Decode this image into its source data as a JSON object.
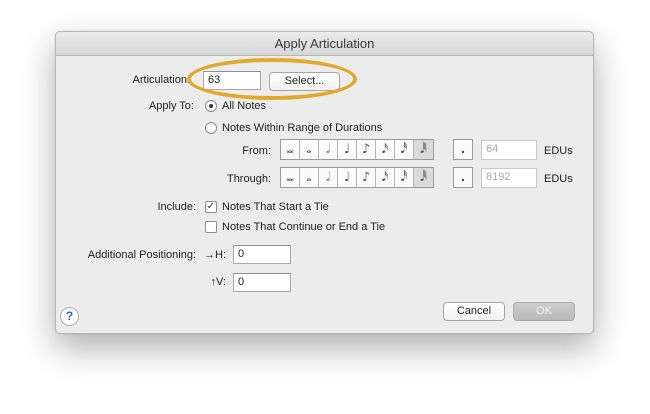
{
  "window": {
    "title": "Apply Articulation"
  },
  "articulation": {
    "label": "Articulation:",
    "value": "63",
    "select_label": "Select..."
  },
  "apply_to": {
    "label": "Apply To:",
    "options": [
      {
        "label": "All Notes",
        "selected": true
      },
      {
        "label": "Notes Within Range of Durations",
        "selected": false
      }
    ]
  },
  "durations": {
    "icons": [
      "𝅜",
      "𝅝",
      "𝅗𝅥",
      "♩",
      "♪",
      "𝅘𝅥𝅯",
      "𝅘𝅥𝅰",
      "𝅘𝅥𝅱"
    ],
    "dot": ".",
    "from": {
      "label": "From:",
      "value": "64",
      "unit": "EDUs"
    },
    "through": {
      "label": "Through:",
      "value": "8192",
      "unit": "EDUs"
    }
  },
  "include": {
    "label": "Include:",
    "options": [
      {
        "label": "Notes That Start a Tie",
        "checked": true
      },
      {
        "label": "Notes That Continue or End a Tie",
        "checked": false
      }
    ]
  },
  "positioning": {
    "label": "Additional Positioning:",
    "h_label": "→H:",
    "h_value": "0",
    "v_label": "↑V:",
    "v_value": "0"
  },
  "buttons": {
    "cancel": "Cancel",
    "ok": "OK",
    "help": "?"
  },
  "accent_colors": {
    "highlight": "#e0a92c",
    "help": "#2a6bd8"
  }
}
